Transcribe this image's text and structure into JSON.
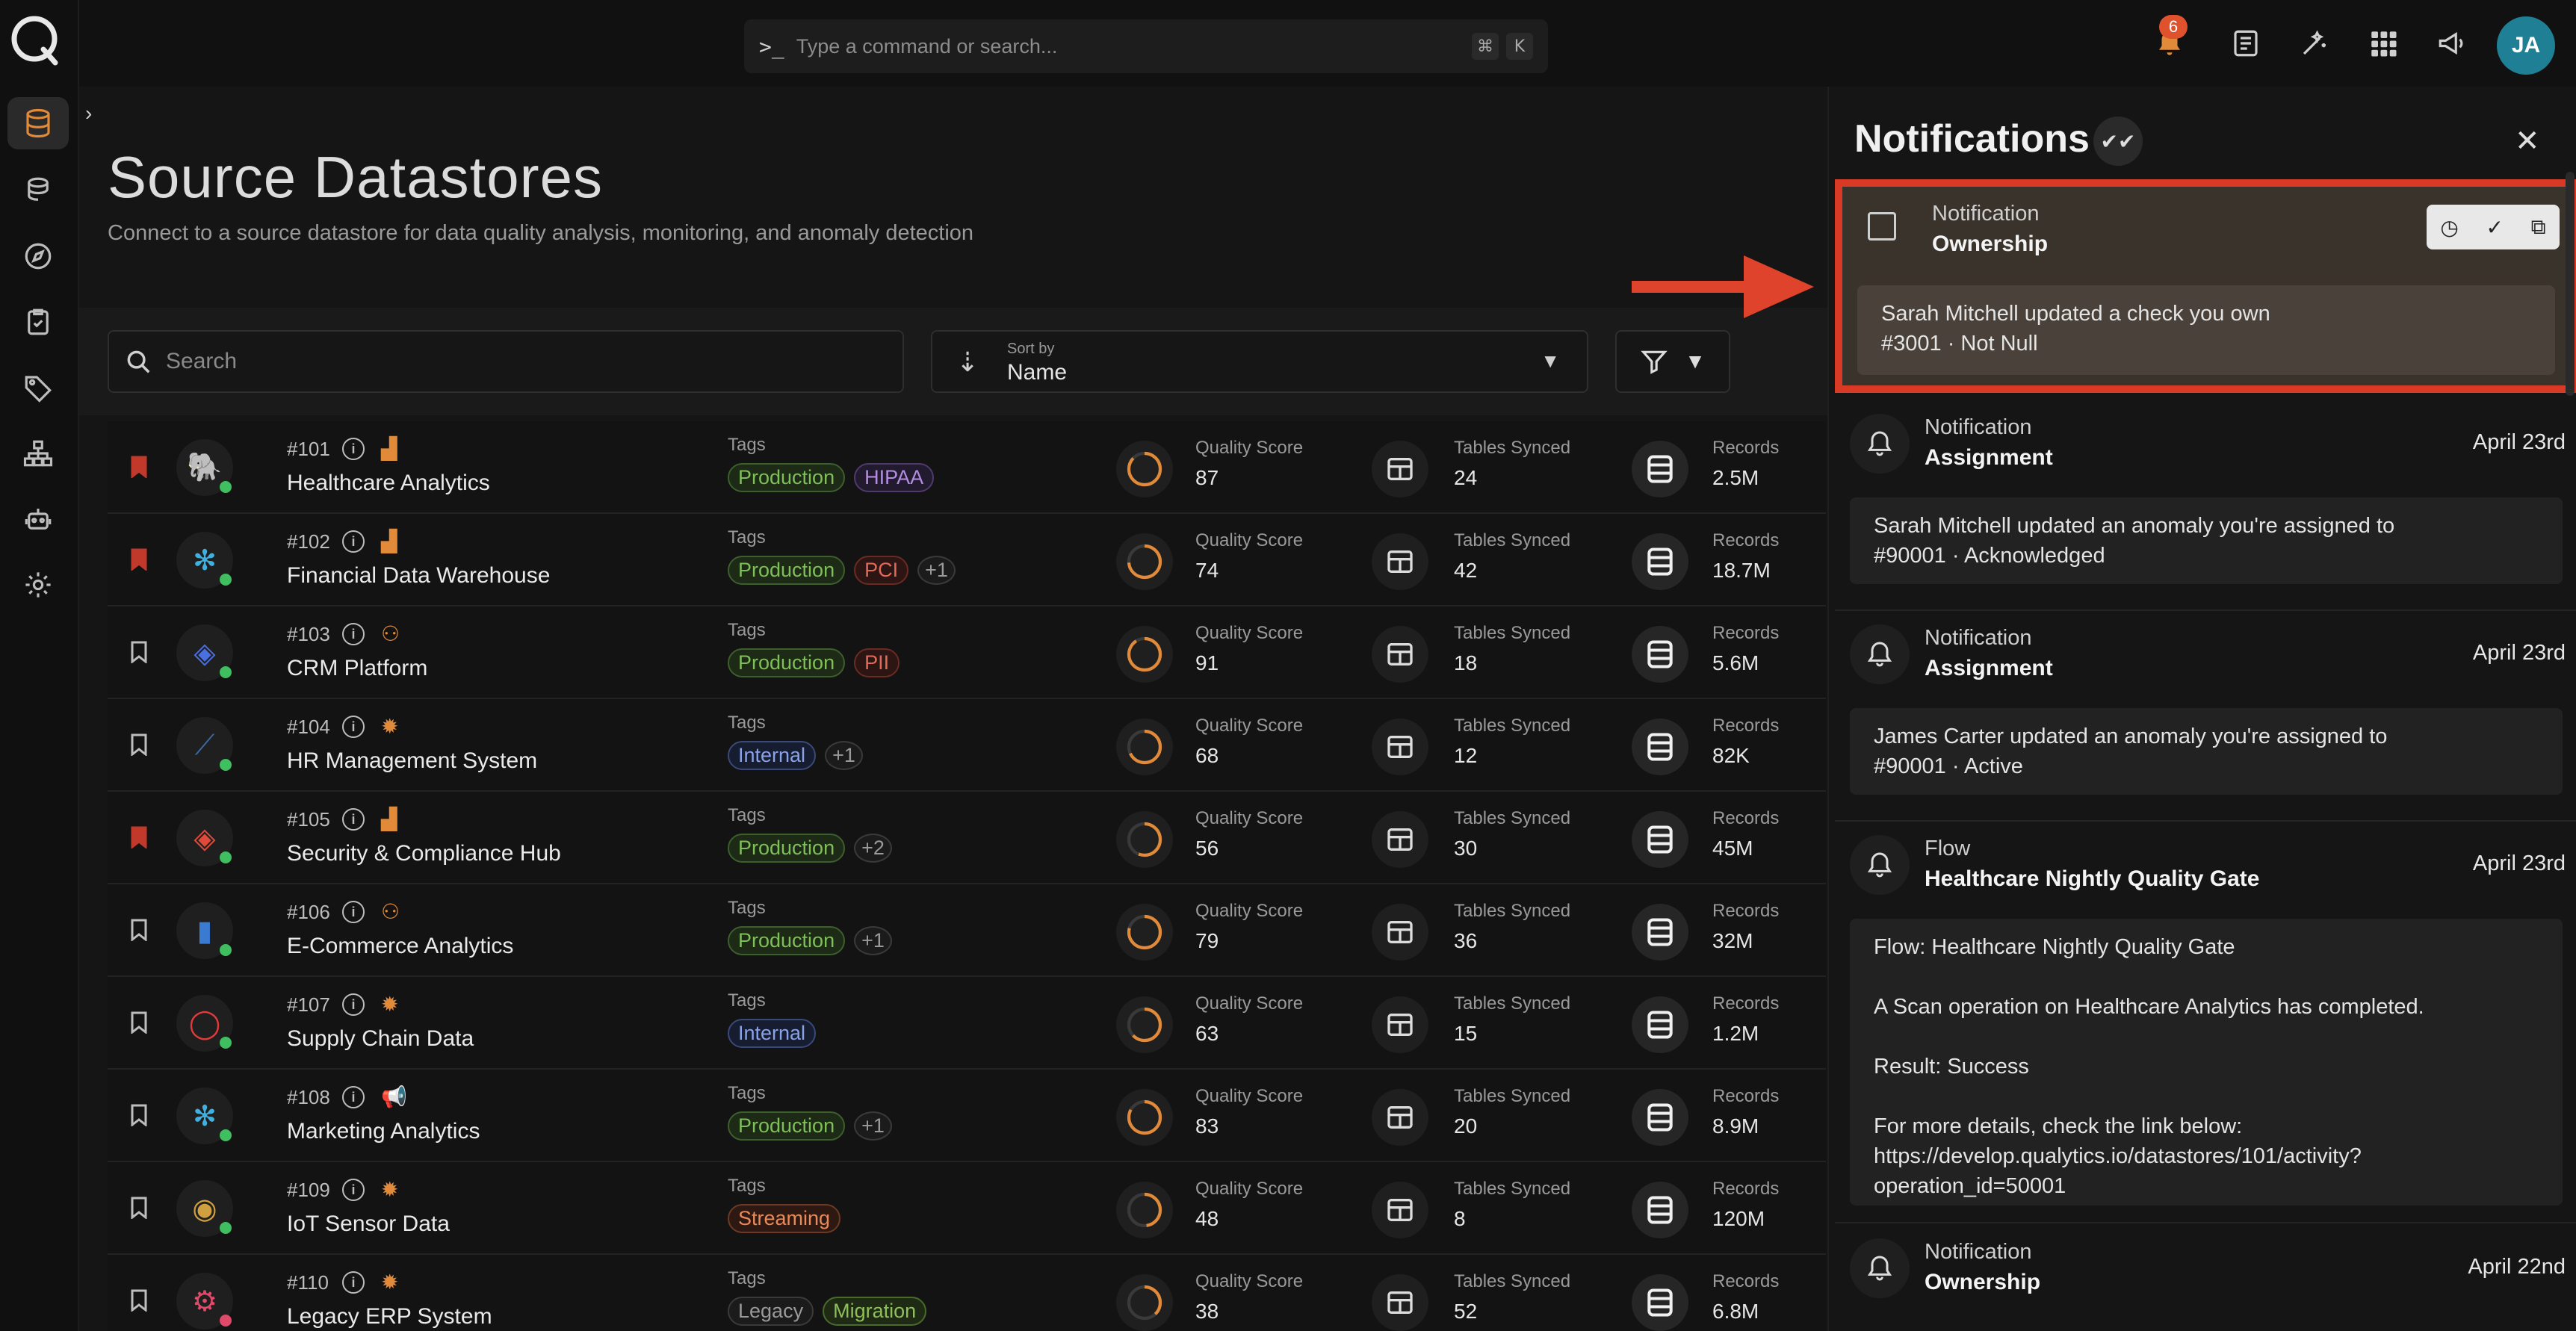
{
  "topbar": {
    "command_placeholder": "Type a command or search...",
    "shortcut_key1": "⌘",
    "shortcut_key2": "K",
    "notification_count": "6",
    "user_initials": "JA"
  },
  "page": {
    "title": "Source Datastores",
    "subtitle": "Connect to a source datastore for data quality analysis, monitoring, and anomaly detection"
  },
  "toolbar": {
    "search_placeholder": "Search",
    "sort_label": "Sort by",
    "sort_value": "Name"
  },
  "columns": {
    "tags": "Tags",
    "quality": "Quality Score",
    "tables": "Tables Synced",
    "records": "Records"
  },
  "datastores": [
    {
      "id": "#101",
      "name": "Healthcare Analytics",
      "tags": [
        "Production",
        "HIPAA"
      ],
      "quality": "87",
      "tables": "24",
      "records": "2.5M",
      "bookmarked": true
    },
    {
      "id": "#102",
      "name": "Financial Data Warehouse",
      "tags": [
        "Production",
        "PCI",
        "+1"
      ],
      "quality": "74",
      "tables": "42",
      "records": "18.7M",
      "bookmarked": true
    },
    {
      "id": "#103",
      "name": "CRM Platform",
      "tags": [
        "Production",
        "PII"
      ],
      "quality": "91",
      "tables": "18",
      "records": "5.6M",
      "bookmarked": false
    },
    {
      "id": "#104",
      "name": "HR Management System",
      "tags": [
        "Internal",
        "+1"
      ],
      "quality": "68",
      "tables": "12",
      "records": "82K",
      "bookmarked": false
    },
    {
      "id": "#105",
      "name": "Security & Compliance Hub",
      "tags": [
        "Production",
        "+2"
      ],
      "quality": "56",
      "tables": "30",
      "records": "45M",
      "bookmarked": true
    },
    {
      "id": "#106",
      "name": "E-Commerce Analytics",
      "tags": [
        "Production",
        "+1"
      ],
      "quality": "79",
      "tables": "36",
      "records": "32M",
      "bookmarked": false
    },
    {
      "id": "#107",
      "name": "Supply Chain Data",
      "tags": [
        "Internal"
      ],
      "quality": "63",
      "tables": "15",
      "records": "1.2M",
      "bookmarked": false
    },
    {
      "id": "#108",
      "name": "Marketing Analytics",
      "tags": [
        "Production",
        "+1"
      ],
      "quality": "83",
      "tables": "20",
      "records": "8.9M",
      "bookmarked": false
    },
    {
      "id": "#109",
      "name": "IoT Sensor Data",
      "tags": [
        "Streaming"
      ],
      "quality": "48",
      "tables": "8",
      "records": "120M",
      "bookmarked": false
    },
    {
      "id": "#110",
      "name": "Legacy ERP System",
      "tags": [
        "Legacy",
        "Migration"
      ],
      "quality": "38",
      "tables": "52",
      "records": "6.8M",
      "bookmarked": false
    }
  ],
  "notifications": {
    "title": "Notifications",
    "items": [
      {
        "kind": "Notification",
        "subject": "Ownership",
        "date": "",
        "line1": "Sarah Mitchell updated a check you own",
        "line2": "#3001 · Not Null"
      },
      {
        "kind": "Notification",
        "subject": "Assignment",
        "date": "April 23rd",
        "line1": "Sarah Mitchell updated an anomaly you're assigned to",
        "line2": "#90001 · Acknowledged"
      },
      {
        "kind": "Notification",
        "subject": "Assignment",
        "date": "April 23rd",
        "line1": "James Carter updated an anomaly you're assigned to",
        "line2": "#90001 · Active"
      },
      {
        "kind": "Flow",
        "subject": "Healthcare Nightly Quality Gate",
        "date": "April 23rd",
        "flow_line": "Flow: Healthcare Nightly Quality Gate",
        "scan_line": "A Scan operation on Healthcare Analytics has completed.",
        "result_line": "Result: Success",
        "details_line": "For more details, check the link below:",
        "link_line1": "https://develop.qualytics.io/datastores/101/activity?",
        "link_line2": "operation_id=50001"
      },
      {
        "kind": "Notification",
        "subject": "Ownership",
        "date": "April 22nd"
      }
    ]
  }
}
